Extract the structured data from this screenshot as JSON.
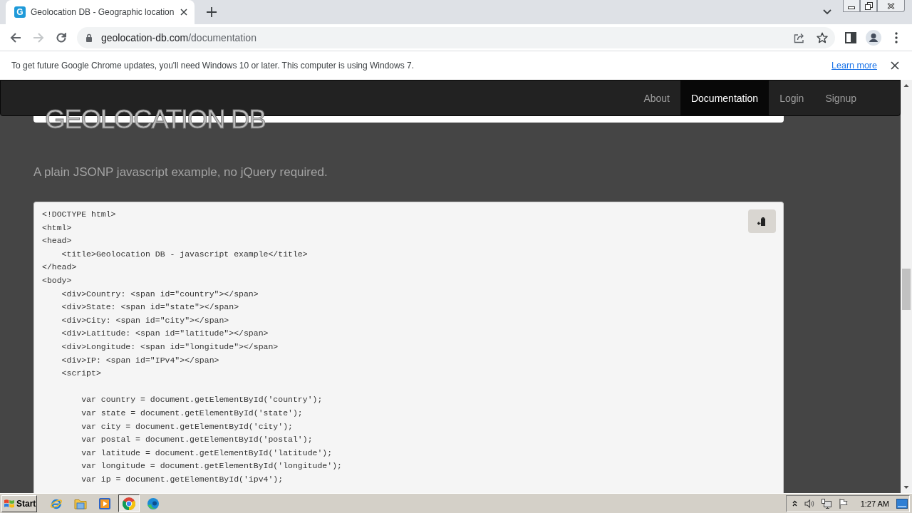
{
  "tab": {
    "favicon_letter": "G",
    "title": "Geolocation DB - Geographic location"
  },
  "toolbar": {
    "back": {
      "disabled": false
    },
    "forward": {
      "disabled": true
    },
    "address": {
      "host": "geolocation-db.com",
      "path": "/documentation"
    }
  },
  "infobar": {
    "message": "To get future Google Chrome updates, you'll need Windows 10 or later. This computer is using Windows 7.",
    "link": "Learn more"
  },
  "site": {
    "nav": [
      {
        "label": "About",
        "selected": false
      },
      {
        "label": "Documentation",
        "selected": true
      },
      {
        "label": "Login",
        "selected": false
      },
      {
        "label": "Signup",
        "selected": false
      }
    ],
    "heading": "GEOLOCATION DB",
    "intro": "A plain JSONP javascript example, no jQuery required.",
    "code": "<!DOCTYPE html>\n<html>\n<head>\n    <title>Geolocation DB - javascript example</title>\n</head>\n<body>\n    <div>Country: <span id=\"country\"></span>\n    <div>State: <span id=\"state\"></span>\n    <div>City: <span id=\"city\"></span>\n    <div>Latitude: <span id=\"latitude\"></span>\n    <div>Longitude: <span id=\"longitude\"></span>\n    <div>IP: <span id=\"IPv4\"></span>\n    <script>\n\n        var country = document.getElementById('country');\n        var state = document.getElementById('state');\n        var city = document.getElementById('city');\n        var postal = document.getElementById('postal');\n        var latitude = document.getElementById('latitude');\n        var longitude = document.getElementById('longitude');\n        var ip = document.getElementById('ipv4');"
  },
  "taskbar": {
    "start": "Start",
    "apps": [
      {
        "selected": false
      },
      {
        "selected": false
      },
      {
        "selected": false
      },
      {
        "selected": true
      },
      {
        "selected": false
      }
    ],
    "clock": "1:27 AM"
  }
}
